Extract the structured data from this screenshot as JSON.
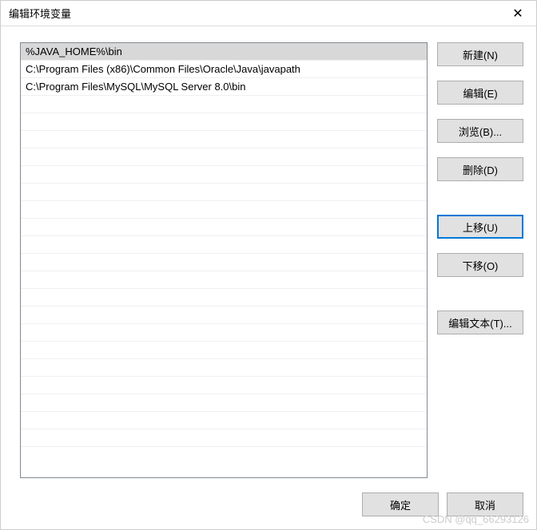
{
  "window": {
    "title": "编辑环境变量",
    "close_symbol": "✕"
  },
  "list": {
    "items": [
      "%JAVA_HOME%\\bin",
      "C:\\Program Files (x86)\\Common Files\\Oracle\\Java\\javapath",
      "C:\\Program Files\\MySQL\\MySQL Server 8.0\\bin"
    ],
    "selected_index": 0
  },
  "buttons": {
    "new": "新建(N)",
    "edit": "编辑(E)",
    "browse": "浏览(B)...",
    "delete": "删除(D)",
    "move_up": "上移(U)",
    "move_down": "下移(O)",
    "edit_text": "编辑文本(T)..."
  },
  "footer": {
    "ok": "确定",
    "cancel": "取消"
  },
  "watermark": "CSDN @qq_66293126"
}
